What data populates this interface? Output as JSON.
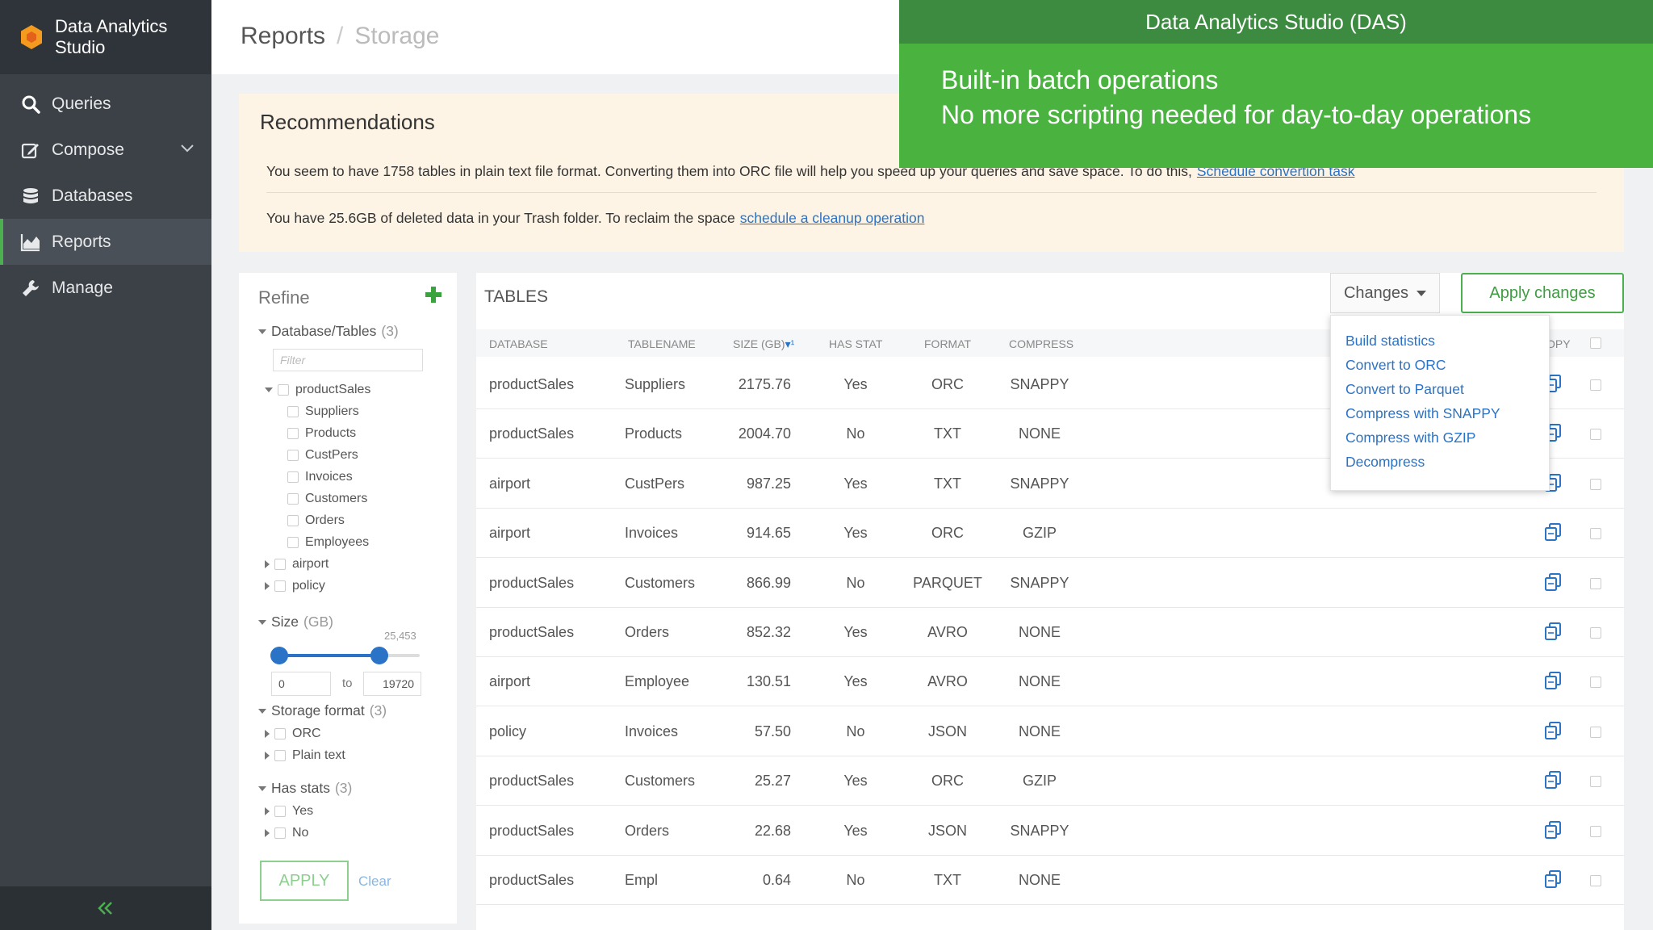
{
  "app": {
    "name_line1": "Data Analytics",
    "name_line2": "Studio"
  },
  "sidebar": {
    "items": [
      {
        "label": "Queries",
        "icon": "search-icon"
      },
      {
        "label": "Compose",
        "icon": "edit-icon"
      },
      {
        "label": "Databases",
        "icon": "database-icon"
      },
      {
        "label": "Reports",
        "icon": "chart-icon",
        "active": true
      },
      {
        "label": "Manage",
        "icon": "wrench-icon"
      }
    ]
  },
  "breadcrumb": {
    "root": "Reports",
    "separator": "/",
    "current": "Storage"
  },
  "recommendations": {
    "title": "Recommendations",
    "line1_text": "You seem to have 1758 tables in plain text file format. Converting them into ORC file will help you speed up your queries and save space. To do this,",
    "line1_link": "Schedule convertion task",
    "line2_text": "You have 25.6GB of deleted data in your Trash folder. To reclaim the space",
    "line2_link": "schedule a cleanup operation"
  },
  "overlay": {
    "title": "Data Analytics Studio (DAS)",
    "line1": "Built-in batch operations",
    "line2": "No more scripting needed for day-to-day operations"
  },
  "refine": {
    "title": "Refine",
    "db_group": {
      "label": "Database/Tables",
      "count": "(3)"
    },
    "filter_placeholder": "Filter",
    "tree": {
      "productSales": {
        "label": "productSales",
        "children": [
          "Suppliers",
          "Products",
          "CustPers",
          "Invoices",
          "Customers",
          "Orders",
          "Employees"
        ]
      },
      "airport": "airport",
      "policy": "policy"
    },
    "size_group": {
      "label": "Size",
      "unit": "(GB)",
      "max": "25,453",
      "from": "0",
      "to_label": "to",
      "to": "19720",
      "range_fraction": [
        0.0,
        0.775
      ]
    },
    "format_group": {
      "label": "Storage format",
      "count": "(3)",
      "items": [
        "ORC",
        "Plain text"
      ]
    },
    "stats_group": {
      "label": "Has stats",
      "count": "(3)",
      "items": [
        "Yes",
        "No"
      ]
    },
    "apply_label": "APPLY",
    "clear_label": "Clear"
  },
  "tables": {
    "title": "TABLES",
    "changes_label": "Changes",
    "apply_changes_label": "Apply changes",
    "headers": {
      "database": "DATABASE",
      "tablename": "TABLENAME",
      "size": "SIZE (GB)",
      "sort": "▾¹",
      "has_stat": "HAS STAT",
      "format": "FORMAT",
      "compress": "COMPRESS",
      "copy": "OPY"
    },
    "rows": [
      [
        "productSales",
        "Suppliers",
        "2175.76",
        "Yes",
        "ORC",
        "SNAPPY"
      ],
      [
        "productSales",
        "Products",
        "2004.70",
        "No",
        "TXT",
        "NONE"
      ],
      [
        "airport",
        "CustPers",
        "987.25",
        "Yes",
        "TXT",
        "SNAPPY"
      ],
      [
        "airport",
        "Invoices",
        "914.65",
        "Yes",
        "ORC",
        "GZIP"
      ],
      [
        "productSales",
        "Customers",
        "866.99",
        "No",
        "PARQUET",
        "SNAPPY"
      ],
      [
        "productSales",
        "Orders",
        "852.32",
        "Yes",
        "AVRO",
        "NONE"
      ],
      [
        "airport",
        "Employee",
        "130.51",
        "Yes",
        "AVRO",
        "NONE"
      ],
      [
        "policy",
        "Invoices",
        "57.50",
        "No",
        "JSON",
        "NONE"
      ],
      [
        "productSales",
        "Customers",
        "25.27",
        "Yes",
        "ORC",
        "GZIP"
      ],
      [
        "productSales",
        "Orders",
        "22.68",
        "Yes",
        "JSON",
        "SNAPPY"
      ],
      [
        "productSales",
        "Empl",
        "0.64",
        "No",
        "TXT",
        "NONE"
      ]
    ],
    "dropdown": [
      "Build statistics",
      "Convert to ORC",
      "Convert to Parquet",
      "Compress with SNAPPY",
      "Compress with GZIP",
      "Decompress"
    ]
  },
  "colors": {
    "accent_green": "#4caf50",
    "link_blue": "#2a73c6",
    "overlay_green": "#4ab340",
    "sidebar_bg": "#3c4147"
  }
}
